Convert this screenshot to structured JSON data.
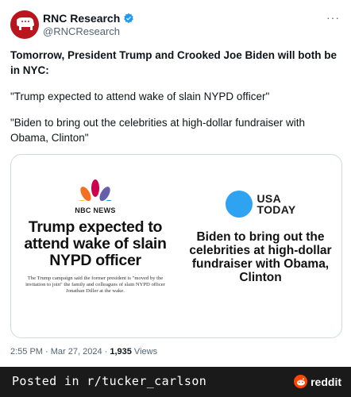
{
  "tweet": {
    "author_name": "RNC Research",
    "handle": "@RNCResearch",
    "lead": "Tomorrow, President Trump and Crooked Joe Biden will both be in NYC:",
    "quote1": "\"Trump expected to attend wake of slain NYPD officer\"",
    "quote2": "\"Biden to bring out the celebrities at high-dollar fundraiser with Obama, Clinton\"",
    "time": "2:55 PM · Mar 27, 2024 · ",
    "views_count": "1,935",
    "views_label": " Views",
    "verified_color": "#1d9bf0"
  },
  "media": {
    "left": {
      "brand": "NBC NEWS",
      "headline": "Trump expected to attend wake of slain NYPD officer",
      "subtext": "The Trump campaign said the former president is \"moved by the invitation to join\" the family and colleagues of slain NYPD officer Jonathan Diller at the wake."
    },
    "right": {
      "brand_line1": "USA",
      "brand_line2": "TODAY",
      "headline": "Biden to bring out the celebrities at high-dollar fundraiser with Obama, Clinton"
    }
  },
  "footer": {
    "posted_in": "Posted in r/tucker_carlson",
    "site": "reddit"
  }
}
